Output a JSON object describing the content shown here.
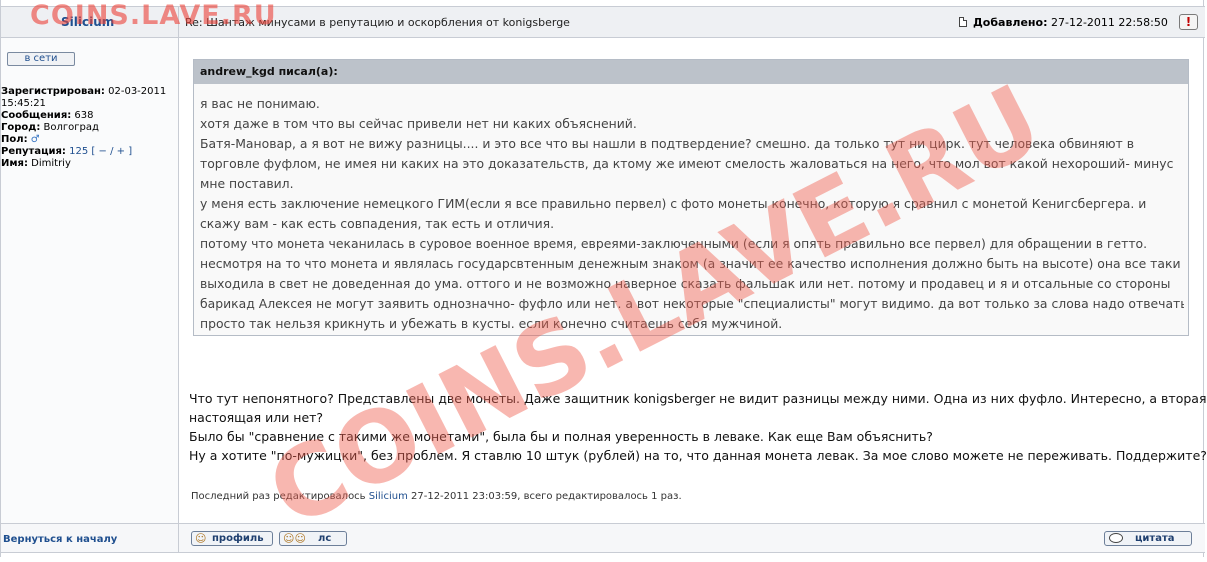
{
  "header": {
    "author": "Silicium",
    "subject": "Re: Шантаж минусами в репутацию и оскорбления от konigsberge",
    "added_label": "Добавлено:",
    "added_date": "27-12-2011 22:58:50",
    "report_symbol": "!"
  },
  "sidebar": {
    "online_label": "в сети",
    "registered_label": "Зарегистрирован:",
    "registered_value": "02-03-2011 15:45:21",
    "posts_label": "Сообщения:",
    "posts_value": "638",
    "city_label": "Город:",
    "city_value": "Волгоград",
    "gender_label": "Пол:",
    "gender_icon": "male-icon",
    "rep_label": "Репутация:",
    "rep_value": "125",
    "rep_open": "[",
    "rep_minus": "−",
    "rep_sep": "/",
    "rep_plus": "+",
    "rep_close": "]",
    "name_label": "Имя:",
    "name_value": "Dimitriy"
  },
  "quote": {
    "header": "andrew_kgd писал(а):",
    "lines": [
      "я вас не понимаю.",
      "хотя даже в том что вы сейчас привели нет ни каких объяснений.",
      "Батя-Мановар, а я вот не вижу разницы.... и это все что вы нашли в подтвердение? смешно. да только тут ни цирк. тут человека обвиняют в",
      "торговле фуфлом, не имея ни каких на это доказательств, да ктому же имеют смелость жаловаться на него, что мол вот какой нехороший- минус",
      "мне поставил.",
      "у меня есть заключение немецкого ГИМ(если я все правильно первел) с фото монеты конечно, которую я сравнил с монетой Кенигсбергера. и",
      "скажу вам - как есть совпадения, так есть и отличия.",
      "потому что монета чеканилась в суровое военное время, евреями-заключенными (если я опять правильно все первел) для обращении в гетто.",
      "несмотря на то что монета и являлась государсвтенным денежным знаком (а значит ее качество исполнения должно быть на высоте) она все таки",
      "выходила в свет не доведенная до ума. оттого и не возможно наверное сказать фальшак или нет. потому и продавец и я и отсальные со стороны",
      "барикад Алексея не могут заявить однозначно- фуфло или нет. а вот некоторые \"специалисты\" могут видимо. да вот только за слова надо отвечать.",
      "просто так нельзя крикнуть и убежать в кусты. если конечно считаешь себя мужчиной."
    ]
  },
  "message": {
    "lines": [
      "Что тут непонятного? Представлены две монеты. Даже защитник konigsberger не видит разницы между ними. Одна из них фуфло. Интересно, а вторая",
      "настоящая или нет?",
      "Было бы \"сравнение с такими же монетами\", была бы и полная уверенность в леваке. Как еще Вам объяснить?",
      "Ну а хотите \"по-мужицки\", без проблем. Я ставлю 10 штук (рублей) на то, что данная монета левак. За мое слово можете не переживать. Поддержите?"
    ]
  },
  "edited": {
    "prefix": "Последний раз редактировалось",
    "user": "Silicium",
    "suffix": "27-12-2011 23:03:59, всего редактировалось 1 раз."
  },
  "footer": {
    "back_label": "Вернуться к началу",
    "profile_label": "профиль",
    "pm_label": "лс",
    "quote_label": "цитата"
  },
  "watermark": {
    "top": "COINS.LAVE.RU",
    "diagonal": "COINS.LAVE.RU"
  }
}
